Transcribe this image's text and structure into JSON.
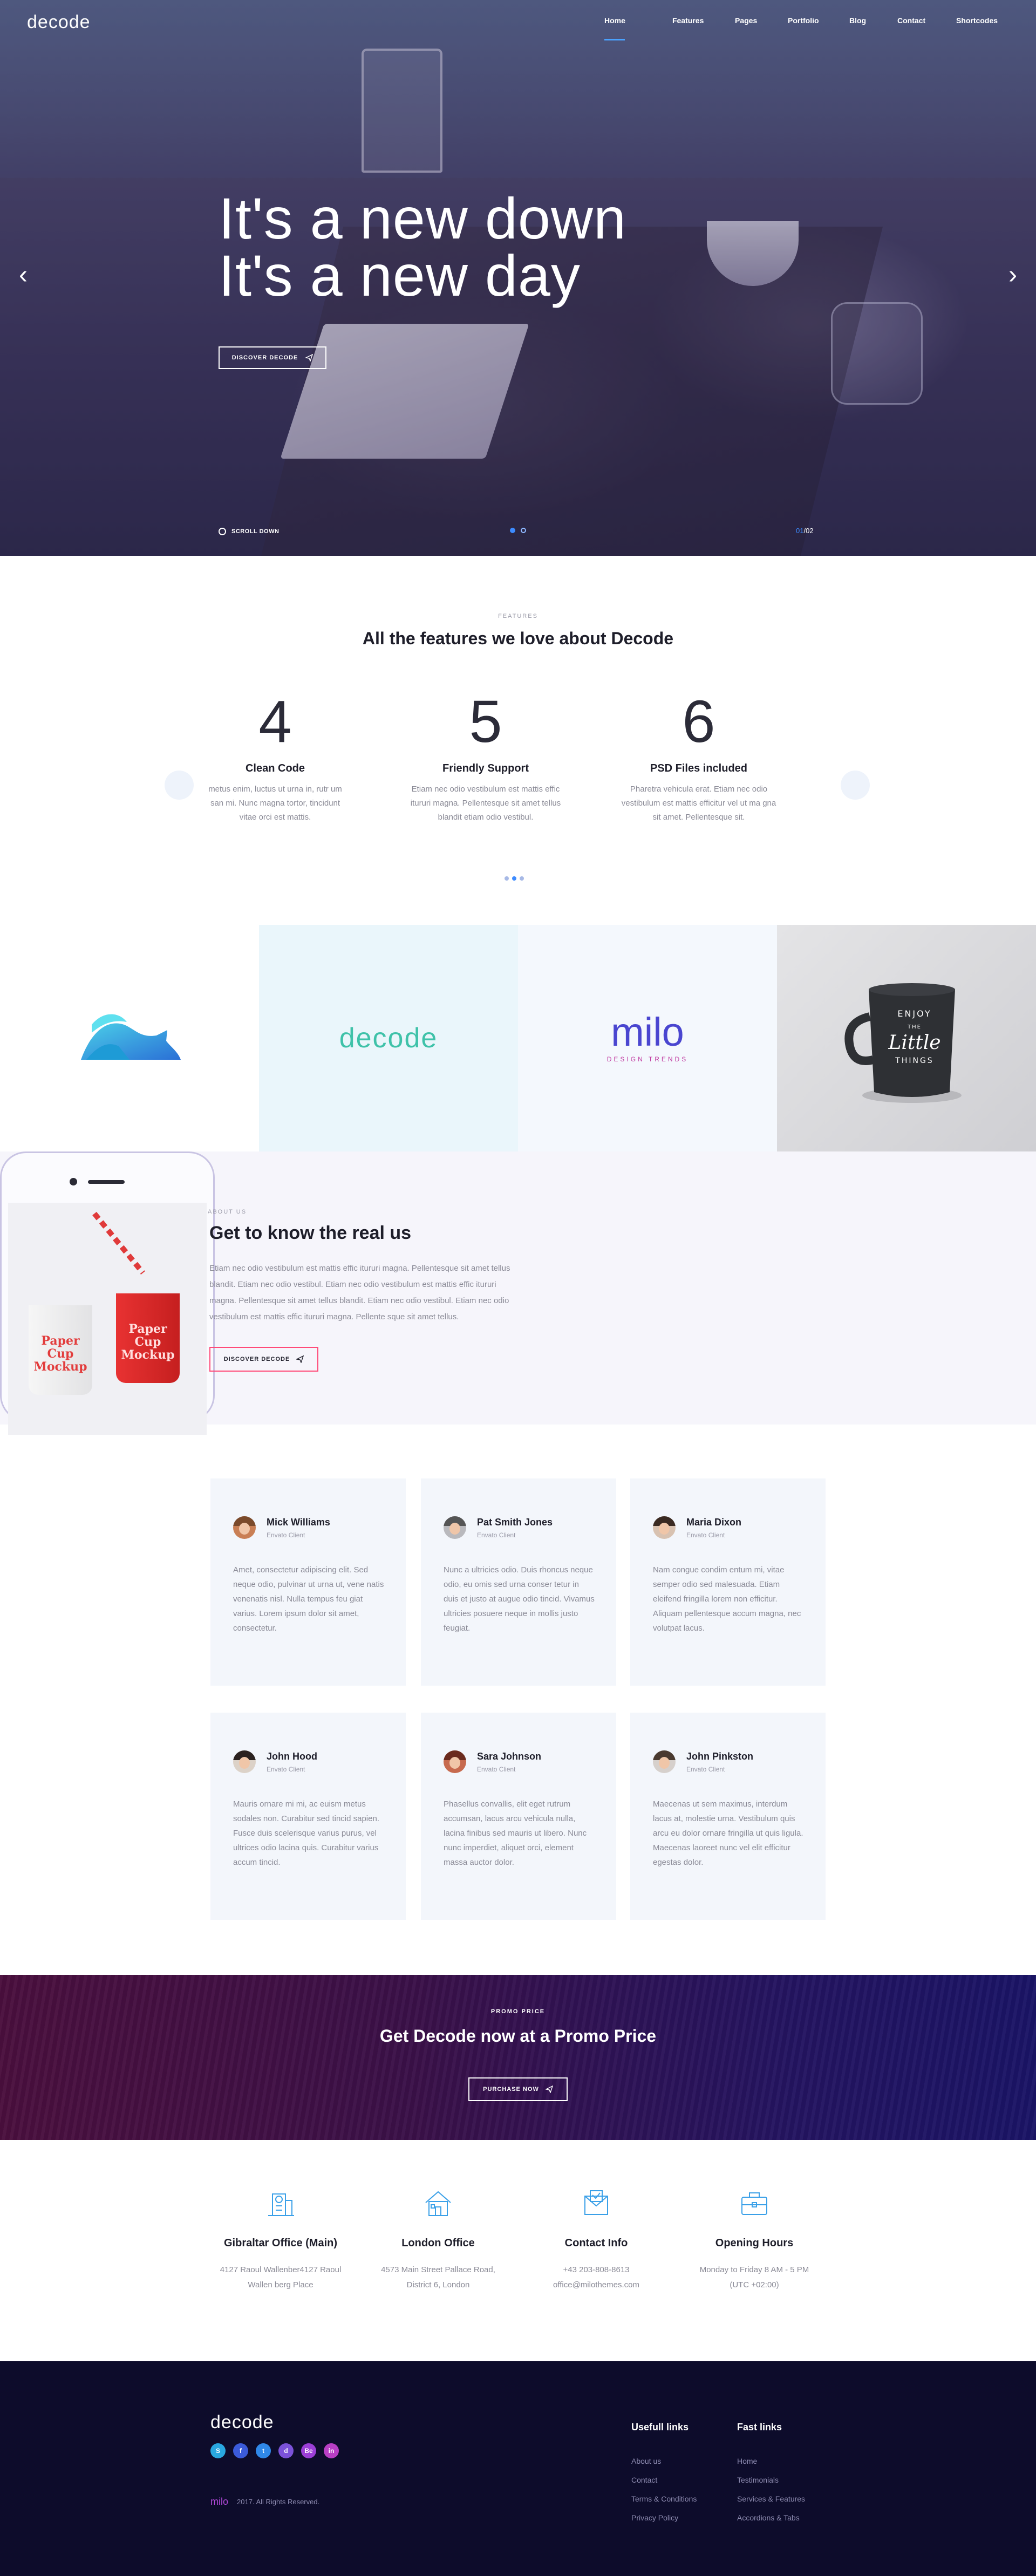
{
  "brand": {
    "logo": "decode"
  },
  "nav": {
    "items": [
      "Home",
      "Features",
      "Pages",
      "Portfolio",
      "Blog",
      "Contact",
      "Shortcodes"
    ],
    "active": "Home"
  },
  "hero": {
    "line1": "It's a new down",
    "line2": "It's a new day",
    "button": "DISCOVER DECODE",
    "scroll_label": "SCROLL DOWN",
    "slide_current": "01",
    "slide_total": "/02",
    "slide_count": 2
  },
  "features": {
    "eyebrow": "FEATURES",
    "heading": "All the features we love about Decode",
    "items": [
      {
        "number": "4",
        "title": "Clean Code",
        "text": "metus enim, luctus ut urna in, rutr um\nsan mi. Nunc magna tortor, tincidunt\nvitae orci est mattis."
      },
      {
        "number": "5",
        "title": "Friendly Support",
        "text": "Etiam nec odio vestibulum est mattis effic\nitururi magna. Pellentesque sit amet tellus\nblandit etiam odio vestibul."
      },
      {
        "number": "6",
        "title": "PSD Files included",
        "text": "Pharetra vehicula erat. Etiam nec odio\nvestibulum est mattis efficitur vel ut ma gna\nsit amet. Pellentesque sit."
      }
    ],
    "dots": 3,
    "active_dot": 2
  },
  "logos": {
    "decode": "decode",
    "milo": "milo",
    "milo_sub": "DESIGN TRENDS",
    "mug_lines": [
      "ENJOY",
      "THE",
      "Little",
      "THINGS"
    ]
  },
  "about": {
    "eyebrow": "ABOUT US",
    "title": "Get to know the real us",
    "text": "Etiam nec odio vestibulum est mattis effic itururi magna. Pellentesque sit amet tellus blandit. Etiam nec odio vestibul. Etiam nec odio vestibulum est mattis effic itururi magna. Pellentesque sit amet tellus blandit. Etiam nec odio vestibul. Etiam nec odio vestibulum est mattis effic itururi magna. Pellente sque sit amet tellus.",
    "button": "DISCOVER DECODE",
    "cup_label": [
      "Paper",
      "Cup",
      "Mockup"
    ]
  },
  "testimonials": [
    {
      "name": "Mick Williams",
      "role": "Envato Client",
      "text": "Amet, consectetur adipiscing elit. Sed neque odio, pulvinar ut urna ut, vene natis venenatis nisl. Nulla tempus feu giat varius. Lorem ipsum dolor sit amet, consectetur."
    },
    {
      "name": "Pat Smith Jones",
      "role": "Envato Client",
      "text": "Nunc a ultricies odio. Duis rhoncus neque odio, eu omis sed urna conser tetur in duis et justo at augue odio tincid. Vivamus ultricies posuere neque in mollis justo feugiat."
    },
    {
      "name": "Maria Dixon",
      "role": "Envato Client",
      "text": "Nam congue condim entum mi, vitae semper odio sed malesuada. Etiam eleifend fringilla lorem non efficitur. Aliquam pellentesque accum magna, nec volutpat lacus."
    },
    {
      "name": "John Hood",
      "role": "Envato Client",
      "text": "Mauris ornare mi mi, ac euism metus sodales non. Curabitur sed tincid sapien. Fusce duis scelerisque varius purus, vel ultrices odio lacina quis. Curabitur varius accum tincid."
    },
    {
      "name": "Sara Johnson",
      "role": "Envato Client",
      "text": "Phasellus convallis, elit eget rutrum accumsan, lacus arcu vehicula nulla, lacina finibus sed mauris ut libero. Nunc nunc imperdiet, aliquet orci, element massa auctor dolor."
    },
    {
      "name": "John Pinkston",
      "role": "Envato Client",
      "text": "Maecenas ut sem maximus, interdum lacus at, molestie urna. Vestibulum quis arcu eu dolor ornare fringilla ut quis ligula. Maecenas laoreet nunc vel elit efficitur egestas dolor."
    }
  ],
  "promo": {
    "eyebrow": "PROMO PRICE",
    "title": "Get Decode now at a Promo Price",
    "button": "PURCHASE NOW"
  },
  "contact": [
    {
      "icon": "building-icon",
      "title": "Gibraltar Office (Main)",
      "line1": "4127 Raoul Wallenber4127 Raoul",
      "line2": "Wallen berg Place"
    },
    {
      "icon": "house-icon",
      "title": "London Office",
      "line1": "4573 Main Street Pallace Road,",
      "line2": "District 6, London"
    },
    {
      "icon": "mail-icon",
      "title": "Contact Info",
      "line1": "+43 203-808-8613",
      "line2": "office@milothemes.com"
    },
    {
      "icon": "briefcase-icon",
      "title": "Opening Hours",
      "line1": "Monday to Friday 8 AM - 5 PM",
      "line2": "(UTC +02:00)"
    }
  ],
  "footer": {
    "logo": "decode",
    "socials": [
      "skype",
      "facebook",
      "twitter",
      "dribbble",
      "behance",
      "linkedin"
    ],
    "mini_logo": "milo",
    "copyright": "2017. All Rights Reserved.",
    "col1_title": "Usefull links",
    "col1_links": [
      "About us",
      "Contact",
      "Terms & Conditions",
      "Privacy Policy"
    ],
    "col2_title": "Fast links",
    "col2_links": [
      "Home",
      "Testimonials",
      "Services & Features",
      "Accordions & Tabs"
    ]
  },
  "colors": {
    "accent_blue": "#3d8bff",
    "accent_pink": "#ff4a78",
    "footer_bg": "#0d0c2b",
    "card_bg": "#f3f6fb",
    "icon_blue": "#3aa0e8"
  }
}
